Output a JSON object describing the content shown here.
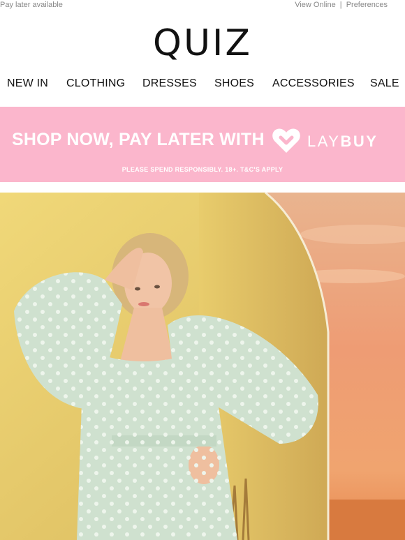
{
  "preheader": {
    "left": "Pay later available",
    "view_online": "View Online",
    "separator": "|",
    "preferences": "Preferences"
  },
  "logo": {
    "text": "QUIZ"
  },
  "nav": {
    "items": [
      {
        "label": "NEW IN"
      },
      {
        "label": "CLOTHING"
      },
      {
        "label": "DRESSES"
      },
      {
        "label": "SHOES"
      },
      {
        "label": "ACCESSORIES"
      },
      {
        "label": "SALE"
      }
    ]
  },
  "banner": {
    "title": "SHOP NOW, PAY LATER WITH",
    "brand_light": "LAY",
    "brand_bold": "BUY",
    "subtext": "PLEASE SPEND RESPONSIBLY. 18+. T&C'S APPLY",
    "background_color": "#fbb6cc"
  },
  "hero": {
    "wall_color": "#e9cf6f",
    "sky_color": "#e7a27c",
    "dress_color": "#cfe1cf"
  }
}
